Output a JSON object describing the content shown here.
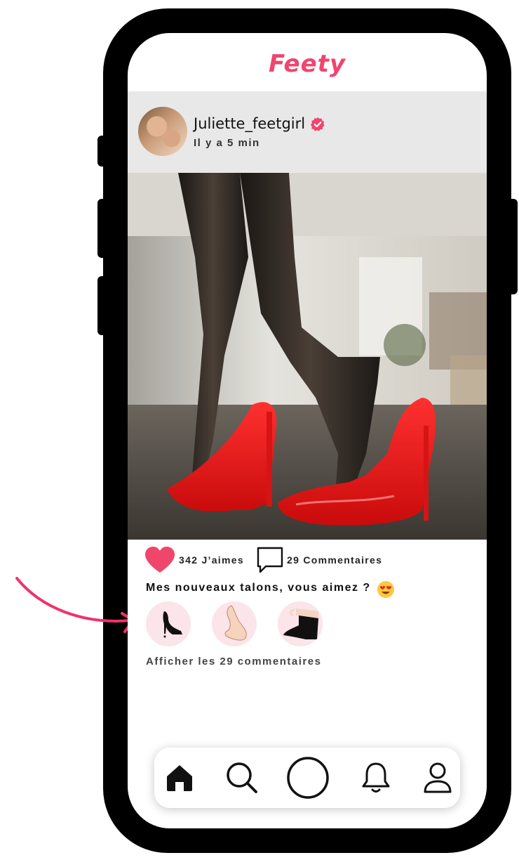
{
  "app": {
    "name": "Feety",
    "brand_color": "#f0456e"
  },
  "post": {
    "username": "Juliette_feetgirl",
    "verified": true,
    "time_ago": "Il y a 5 min",
    "likes_text": "342 J’aimes",
    "comments_text": "29 Commentaires",
    "caption": "Mes nouveaux talons, vous aimez ?",
    "caption_emoji": "heart-eyes-emoji",
    "show_comments_label": "Afficher les 29 commentaires",
    "reaction_stickers": [
      "high-heel-sticker",
      "foot-sticker",
      "stocking-leg-sticker"
    ]
  },
  "nav": {
    "items": [
      "home-icon",
      "search-icon",
      "create-button",
      "notifications-icon",
      "profile-icon"
    ],
    "active": "home-icon"
  }
}
